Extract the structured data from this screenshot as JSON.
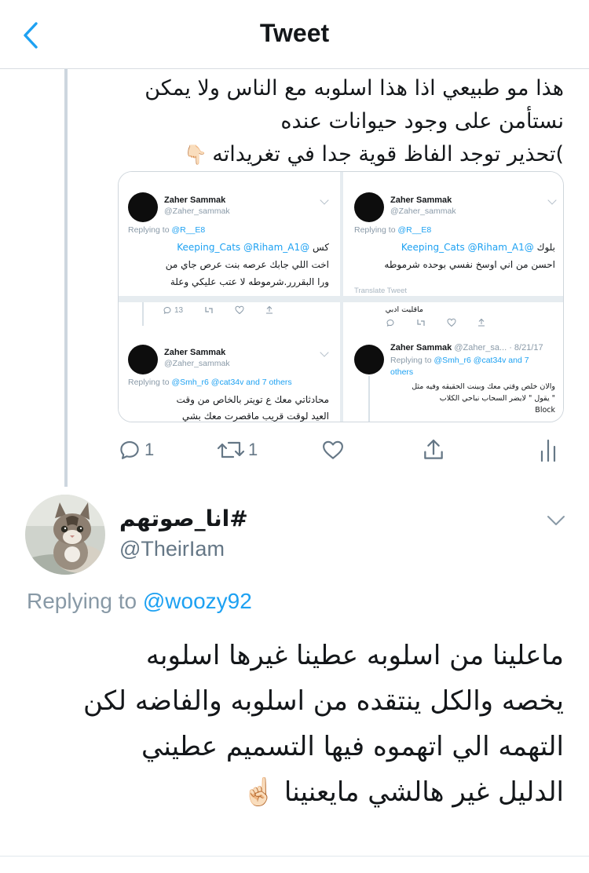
{
  "header": {
    "title": "Tweet",
    "back_icon": "chevron-left-icon",
    "accent": "#1DA1F2"
  },
  "previous_tweet": {
    "text_lines": [
      "هذا مو طبيعي اذا هذا اسلوبه مع الناس ولا يمكن",
      "نستأمن على وجود حيوانات عنده",
      ")تحذير توجد الفاظ قوية جدا في تغريداته"
    ],
    "emoji": "👇🏻",
    "media": {
      "top_left": {
        "name": "Zaher Sammak",
        "handle": "@Zaher_sammak",
        "replying_prefix": "Replying to",
        "replying_to": "@R__E8",
        "text_prefix": "كس",
        "text_mentions": "@Keeping_Cats @Riham_A1",
        "text_lines": [
          "اخت اللي جابك عرصه بنت عرص جاي من",
          "ورا البقررر.شرموطه لا عتب عليكي وعلة"
        ],
        "reply_count": "13"
      },
      "top_right": {
        "name": "Zaher Sammak",
        "handle": "@Zaher_sammak",
        "replying_prefix": "Replying to",
        "replying_to": "@R__E8",
        "text_prefix": "بلوك",
        "text_mentions": "@Keeping_Cats @Riham_A1",
        "text_lines": [
          "احسن من اني اوسخ نفسي بوحده شرموطه"
        ],
        "faint_line": "Translate Tweet"
      },
      "bottom_left": {
        "name": "Zaher Sammak",
        "handle": "@Zaher_sammak",
        "replying_prefix": "Replying to",
        "replying_to": "@Smh_r6 @cat34v and 7 others",
        "text_lines": [
          "محادثاتي معك ع تويتر بالخاص من وقت",
          "العيد لوقت قريب ماقصرت معك بشي"
        ]
      },
      "bottom_right": {
        "top_line": "ماقليت ادبي",
        "name": "Zaher Sammak",
        "handle": "@Zaher_sa...",
        "date": "· 8/21/17",
        "replying_prefix": "Replying to",
        "replying_to": "@Smh_r6 @cat34v and 7",
        "replying_to_2": "others",
        "text_lines": [
          "والان خلص وقتي معك وبينت الحقيقه وفيه مثل",
          "\" يقول \" لايضر السحاب نباحي الكلاب",
          "Block"
        ]
      }
    },
    "actions": {
      "reply_count": "1",
      "retweet_count": "1"
    }
  },
  "reply_tweet": {
    "author_name": "#انا_صوتهم",
    "author_handle": "@TheirIam",
    "avatar_icon": "kitten-avatar",
    "replying_prefix": "Replying to",
    "replying_to": "@woozy92",
    "text_lines": [
      "ماعلينا من اسلوبه عطينا غيرها اسلوبه",
      "يخصه والكل ينتقده من اسلوبه والفاضه لكن",
      "التهمه الي اتهموه فيها التسميم عطيني",
      "الدليل غير هالشي مايعنينا"
    ],
    "emoji": "☝🏻"
  }
}
